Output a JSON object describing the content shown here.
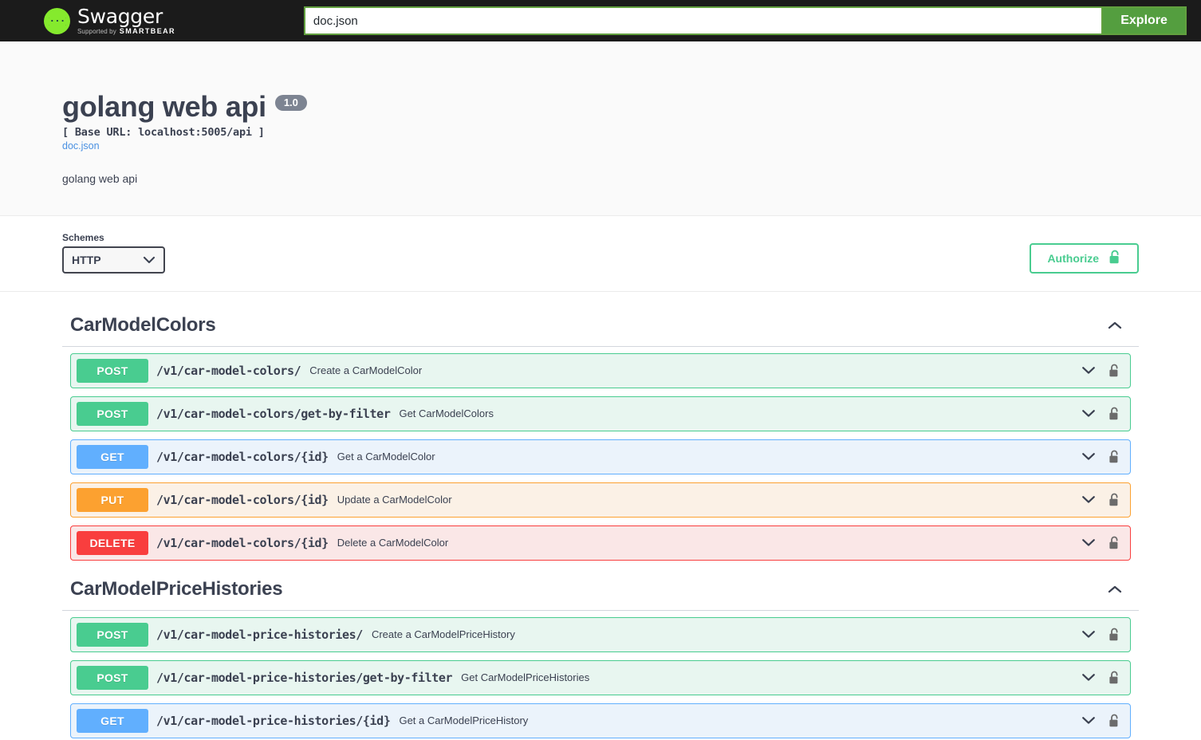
{
  "topbar": {
    "logo_name": "Swagger",
    "logo_supported_by": "Supported by",
    "logo_brand": "SMARTBEAR",
    "url_value": "doc.json",
    "url_placeholder": "doc.json",
    "explore_label": "Explore"
  },
  "info": {
    "title": "golang web api",
    "version": "1.0",
    "base_url": "[ Base URL: localhost:5005/api ]",
    "doc_link": "doc.json",
    "description": "golang web api"
  },
  "schemes": {
    "label": "Schemes",
    "selected": "HTTP",
    "options": [
      "HTTP"
    ],
    "authorize_label": "Authorize"
  },
  "colors": {
    "post": "#49cc90",
    "get": "#61affe",
    "put": "#fca130",
    "delete": "#f93e3e",
    "brand_green": "#85ea2d",
    "explore_green": "#549e3f",
    "link_blue": "#4990e2",
    "version_badge": "#7d8492",
    "topbar_bg": "#1b1b1b"
  },
  "sections": [
    {
      "name": "CarModelColors",
      "expanded": true,
      "operations": [
        {
          "verb": "POST",
          "type": "post",
          "path": "/v1/car-model-colors/",
          "summary": "Create a CarModelColor"
        },
        {
          "verb": "POST",
          "type": "post",
          "path": "/v1/car-model-colors/get-by-filter",
          "summary": "Get CarModelColors"
        },
        {
          "verb": "GET",
          "type": "get",
          "path": "/v1/car-model-colors/{id}",
          "summary": "Get a CarModelColor"
        },
        {
          "verb": "PUT",
          "type": "put",
          "path": "/v1/car-model-colors/{id}",
          "summary": "Update a CarModelColor"
        },
        {
          "verb": "DELETE",
          "type": "delete",
          "path": "/v1/car-model-colors/{id}",
          "summary": "Delete a CarModelColor"
        }
      ]
    },
    {
      "name": "CarModelPriceHistories",
      "expanded": true,
      "operations": [
        {
          "verb": "POST",
          "type": "post",
          "path": "/v1/car-model-price-histories/",
          "summary": "Create a CarModelPriceHistory"
        },
        {
          "verb": "POST",
          "type": "post",
          "path": "/v1/car-model-price-histories/get-by-filter",
          "summary": "Get CarModelPriceHistories"
        },
        {
          "verb": "GET",
          "type": "get",
          "path": "/v1/car-model-price-histories/{id}",
          "summary": "Get a CarModelPriceHistory"
        }
      ]
    }
  ]
}
